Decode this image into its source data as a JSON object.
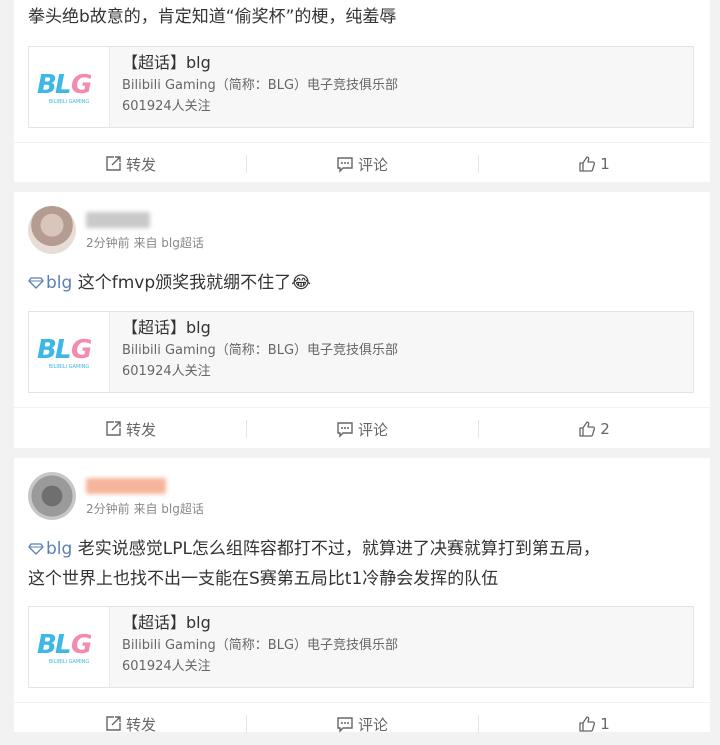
{
  "posts": [
    {
      "text": "拳头绝b故意的，肯定知道“偷奖杯”的梗，纯羞辱",
      "card": {
        "title": "【超话】blg",
        "desc": "Bilibili Gaming（简称：BLG）电子竞技俱乐部",
        "followers": "601924人关注"
      },
      "actions": {
        "repost": "转发",
        "comment": "评论",
        "like": "1"
      }
    },
    {
      "meta": "2分钟前 来自 blg超话",
      "tag": "blg",
      "text": "这个fmvp颁奖我就绷不住了",
      "emoji": "😂",
      "card": {
        "title": "【超话】blg",
        "desc": "Bilibili Gaming（简称：BLG）电子竞技俱乐部",
        "followers": "601924人关注"
      },
      "actions": {
        "repost": "转发",
        "comment": "评论",
        "like": "2"
      }
    },
    {
      "meta": "2分钟前 来自 blg超话",
      "tag": "blg",
      "text_line1": "老实说感觉LPL怎么组阵容都打不过，就算进了决赛就算打到第五局，",
      "text_line2": "这个世界上也找不出一支能在S赛第五局比t1冷静会发挥的队伍",
      "card": {
        "title": "【超话】blg",
        "desc": "Bilibili Gaming（简称：BLG）电子竞技俱乐部",
        "followers": "601924人关注"
      },
      "actions": {
        "repost": "转发",
        "comment": "评论",
        "like": "1"
      }
    }
  ],
  "logo_text": {
    "main": "BLG",
    "sub": "BILIBILI GAMING"
  },
  "icons": {
    "repost": "repost-icon",
    "comment": "comment-icon",
    "like": "thumbs-up-icon",
    "topic": "diamond-tag-icon"
  },
  "colors": {
    "link": "#5b7fb6",
    "logo_blue": "#3db8e6",
    "logo_pink": "#f38ab0",
    "action_text": "#666666"
  }
}
